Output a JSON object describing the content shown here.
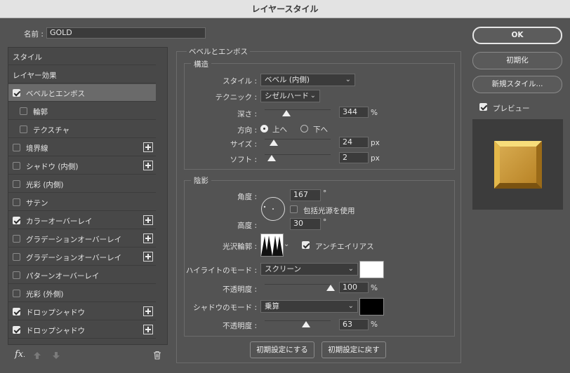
{
  "window": {
    "title": "レイヤースタイル"
  },
  "name_field": {
    "label": "名前 :",
    "value": "GOLD"
  },
  "sidebar": {
    "items": [
      {
        "label": "スタイル",
        "checkbox": false,
        "checked": false,
        "plus": false,
        "selected": false,
        "sub": false
      },
      {
        "label": "レイヤー効果",
        "checkbox": false,
        "checked": false,
        "plus": false,
        "selected": false,
        "sub": false
      },
      {
        "label": "ベベルとエンボス",
        "checkbox": true,
        "checked": true,
        "plus": false,
        "selected": true,
        "sub": false
      },
      {
        "label": "輪郭",
        "checkbox": true,
        "checked": false,
        "plus": false,
        "selected": false,
        "sub": true
      },
      {
        "label": "テクスチャ",
        "checkbox": true,
        "checked": false,
        "plus": false,
        "selected": false,
        "sub": true
      },
      {
        "label": "境界線",
        "checkbox": true,
        "checked": false,
        "plus": true,
        "selected": false,
        "sub": false
      },
      {
        "label": "シャドウ (内側)",
        "checkbox": true,
        "checked": false,
        "plus": true,
        "selected": false,
        "sub": false
      },
      {
        "label": "光彩 (内側)",
        "checkbox": true,
        "checked": false,
        "plus": false,
        "selected": false,
        "sub": false
      },
      {
        "label": "サテン",
        "checkbox": true,
        "checked": false,
        "plus": false,
        "selected": false,
        "sub": false
      },
      {
        "label": "カラーオーバーレイ",
        "checkbox": true,
        "checked": true,
        "plus": true,
        "selected": false,
        "sub": false
      },
      {
        "label": "グラデーションオーバーレイ",
        "checkbox": true,
        "checked": false,
        "plus": true,
        "selected": false,
        "sub": false
      },
      {
        "label": "グラデーションオーバーレイ",
        "checkbox": true,
        "checked": false,
        "plus": true,
        "selected": false,
        "sub": false
      },
      {
        "label": "パターンオーバーレイ",
        "checkbox": true,
        "checked": false,
        "plus": false,
        "selected": false,
        "sub": false
      },
      {
        "label": "光彩 (外側)",
        "checkbox": true,
        "checked": false,
        "plus": false,
        "selected": false,
        "sub": false
      },
      {
        "label": "ドロップシャドウ",
        "checkbox": true,
        "checked": true,
        "plus": true,
        "selected": false,
        "sub": false
      },
      {
        "label": "ドロップシャドウ",
        "checkbox": true,
        "checked": true,
        "plus": true,
        "selected": false,
        "sub": false
      }
    ],
    "footer": {
      "fx_label": "fx"
    }
  },
  "bevel": {
    "section_title": "ベベルとエンボス",
    "structure": {
      "title": "構造",
      "style_label": "スタイル :",
      "style_value": "ベベル (内側)",
      "technique_label": "テクニック :",
      "technique_value": "シゼルハード",
      "depth_label": "深さ :",
      "depth_value": "344",
      "depth_unit": "%",
      "direction_label": "方向 :",
      "direction_up": "上へ",
      "direction_down": "下へ",
      "direction_selected": "up",
      "size_label": "サイズ :",
      "size_value": "24",
      "size_unit": "px",
      "soften_label": "ソフト :",
      "soften_value": "2",
      "soften_unit": "px"
    },
    "shading": {
      "title": "陰影",
      "angle_label": "角度 :",
      "angle_value": "167",
      "angle_unit": "°",
      "global_light_label": "包括光源を使用",
      "global_light_checked": false,
      "altitude_label": "高度 :",
      "altitude_value": "30",
      "altitude_unit": "°",
      "gloss_label": "光沢輪郭 :",
      "antialias_label": "アンチエイリアス",
      "antialias_checked": true,
      "highlight_label": "ハイライトのモード :",
      "highlight_value": "スクリーン",
      "highlight_color": "#ffffff",
      "highlight_opacity_label": "不透明度 :",
      "highlight_opacity_value": "100",
      "highlight_opacity_unit": "%",
      "shadow_label": "シャドウのモード :",
      "shadow_value": "乗算",
      "shadow_color": "#000000",
      "shadow_opacity_label": "不透明度 :",
      "shadow_opacity_value": "63",
      "shadow_opacity_unit": "%"
    },
    "make_default": "初期設定にする",
    "reset_default": "初期設定に戻す"
  },
  "right": {
    "ok": "OK",
    "reset": "初期化",
    "new_style": "新規スタイル...",
    "preview_label": "プレビュー",
    "preview_checked": true
  },
  "icons": {
    "fx": "fx-icon",
    "up": "arrow-up-icon",
    "down": "arrow-down-icon",
    "trash": "trash-icon",
    "chevron": "chevron-down-icon",
    "checkbox": "checkbox-icon",
    "plus": "plus-icon"
  }
}
